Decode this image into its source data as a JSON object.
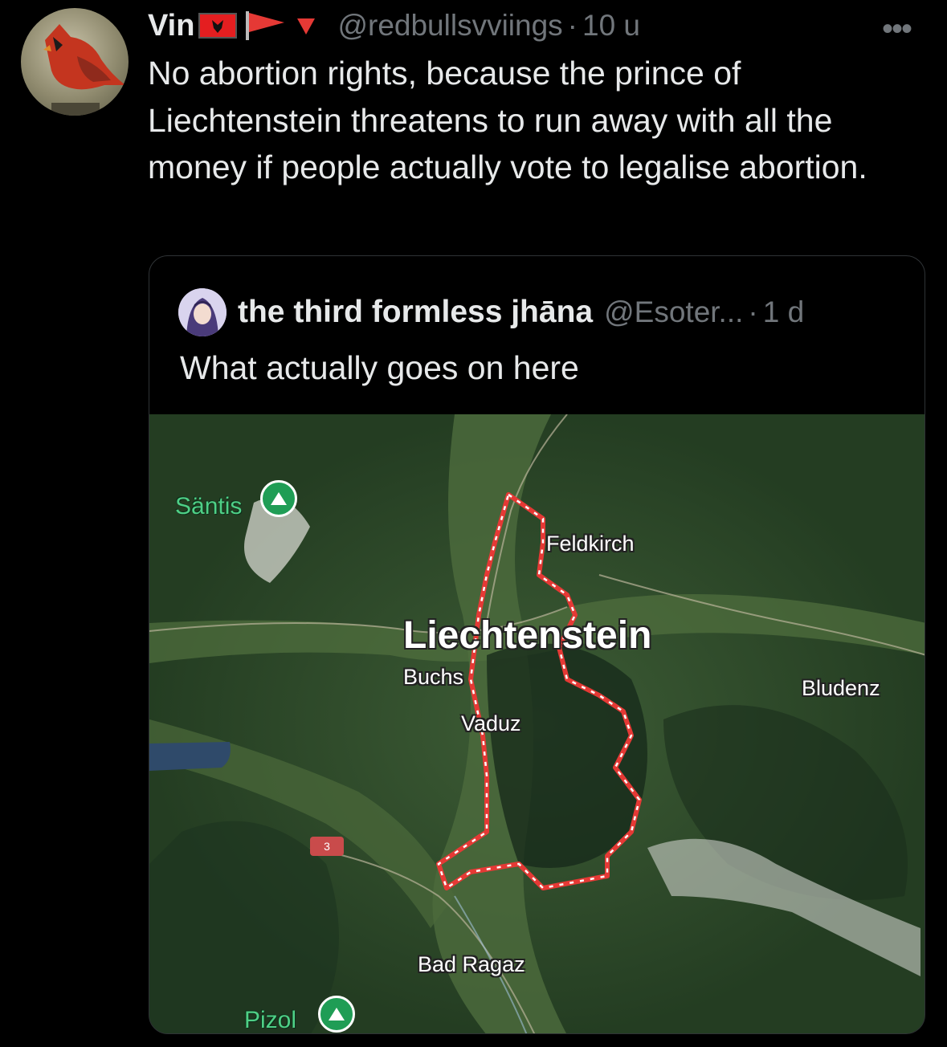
{
  "tweet": {
    "author_name": "Vin",
    "flag_icons": [
      "albania-flag-icon",
      "red-pennant-flag-icon",
      "red-triangle-down-icon"
    ],
    "handle": "@redbullsvviings",
    "separator": "·",
    "time": "10 u",
    "more_label": "•••",
    "text": "No abortion rights, because the prince of Liechtenstein threatens to run away with all the money if people actually vote to legalise abortion."
  },
  "quoted_tweet": {
    "author_name": "the third formless jhāna",
    "handle": "@Esoter...",
    "separator": "·",
    "time": "1 d",
    "text": "What actually goes on here"
  },
  "map": {
    "labels": {
      "santis": "Säntis",
      "feldkirch": "Feldkirch",
      "liechtenstein": "Liechtenstein",
      "buchs": "Buchs",
      "bludenz": "Bludenz",
      "vaduz": "Vaduz",
      "bad_ragaz": "Bad Ragaz",
      "pizol": "Pizol",
      "road_number": "3"
    },
    "border_color": "#e53935"
  }
}
